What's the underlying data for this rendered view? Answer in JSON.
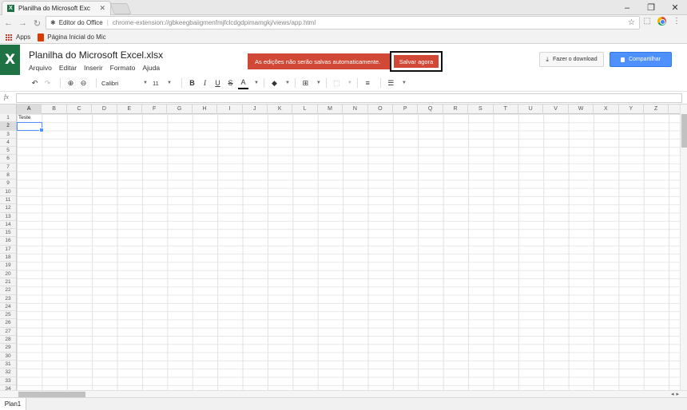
{
  "browser": {
    "tab_title": "Planilha do Microsoft Exc",
    "tab_favicon": "X",
    "window_controls": [
      "–",
      "❐",
      "✕"
    ],
    "origin": "Editor do Office",
    "url": "chrome-extension://gbkeegbaiigmenfmjfclcdgdpimamgkj/views/app.html",
    "bookmarks": {
      "apps": "Apps",
      "home": "Página Inicial do Mic"
    }
  },
  "app": {
    "logo": "X",
    "doc_title": "Planilha do Microsoft Excel.xlsx",
    "menu": [
      "Arquivo",
      "Editar",
      "Inserir",
      "Formato",
      "Ajuda"
    ],
    "banner_msg": "As edições não serão salvas automaticamente.",
    "save_now": "Salvar agora",
    "download": "Fazer o download",
    "share": "Compartilhar",
    "colors": {
      "excel_green": "#1f7244",
      "banner_red": "#d14836",
      "share_blue": "#4d90fe"
    }
  },
  "toolbar": {
    "font": "Calibri",
    "size": "11",
    "bold": "B",
    "italic": "I",
    "underline": "U",
    "strike": "S",
    "text_color": "A"
  },
  "formula": {
    "label": "fx",
    "value": ""
  },
  "sheet": {
    "columns": [
      "A",
      "B",
      "C",
      "D",
      "E",
      "F",
      "G",
      "H",
      "I",
      "J",
      "K",
      "L",
      "M",
      "N",
      "O",
      "P",
      "Q",
      "R",
      "S",
      "T",
      "U",
      "V",
      "W",
      "X",
      "Y",
      "Z"
    ],
    "rows": [
      "1",
      "2",
      "3",
      "4",
      "5",
      "6",
      "7",
      "8",
      "9",
      "10",
      "11",
      "12",
      "13",
      "14",
      "15",
      "16",
      "17",
      "18",
      "19",
      "20",
      "21",
      "22",
      "23",
      "24",
      "25",
      "26",
      "27",
      "28",
      "29",
      "30",
      "31",
      "32",
      "33",
      "34"
    ],
    "cell_a1": "Teste",
    "tabs": [
      "Plan1"
    ]
  }
}
